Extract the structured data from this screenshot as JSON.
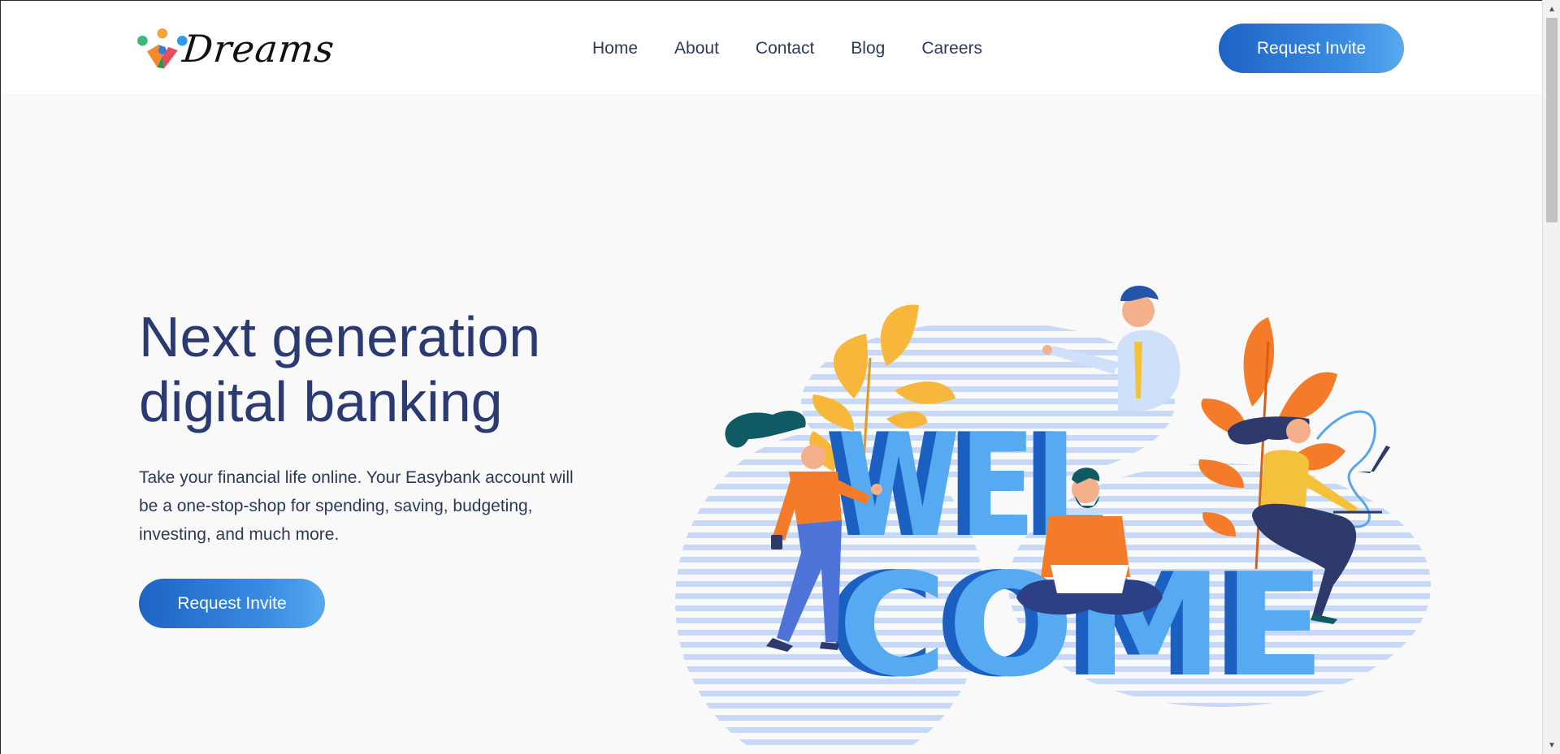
{
  "brand": {
    "name": "Dreams"
  },
  "nav": {
    "items": [
      {
        "label": "Home"
      },
      {
        "label": "About"
      },
      {
        "label": "Contact"
      },
      {
        "label": "Blog"
      },
      {
        "label": "Careers"
      }
    ]
  },
  "header": {
    "cta_label": "Request Invite"
  },
  "hero": {
    "title_line1": "Next generation",
    "title_line2": "digital banking",
    "description": "Take your financial life online. Your Easybank account will be a one-stop-shop for spending, saving, budgeting, investing, and much more.",
    "cta_label": "Request Invite"
  },
  "illustration": {
    "word_top": "WEL",
    "word_bottom": "COME"
  },
  "scrollbar": {
    "up_icon": "▲",
    "down_icon": "▼"
  },
  "colors": {
    "accent": "#2a6fd1",
    "heading": "#2b3a73",
    "text": "#2d3a55",
    "background": "#f9f9f9"
  }
}
